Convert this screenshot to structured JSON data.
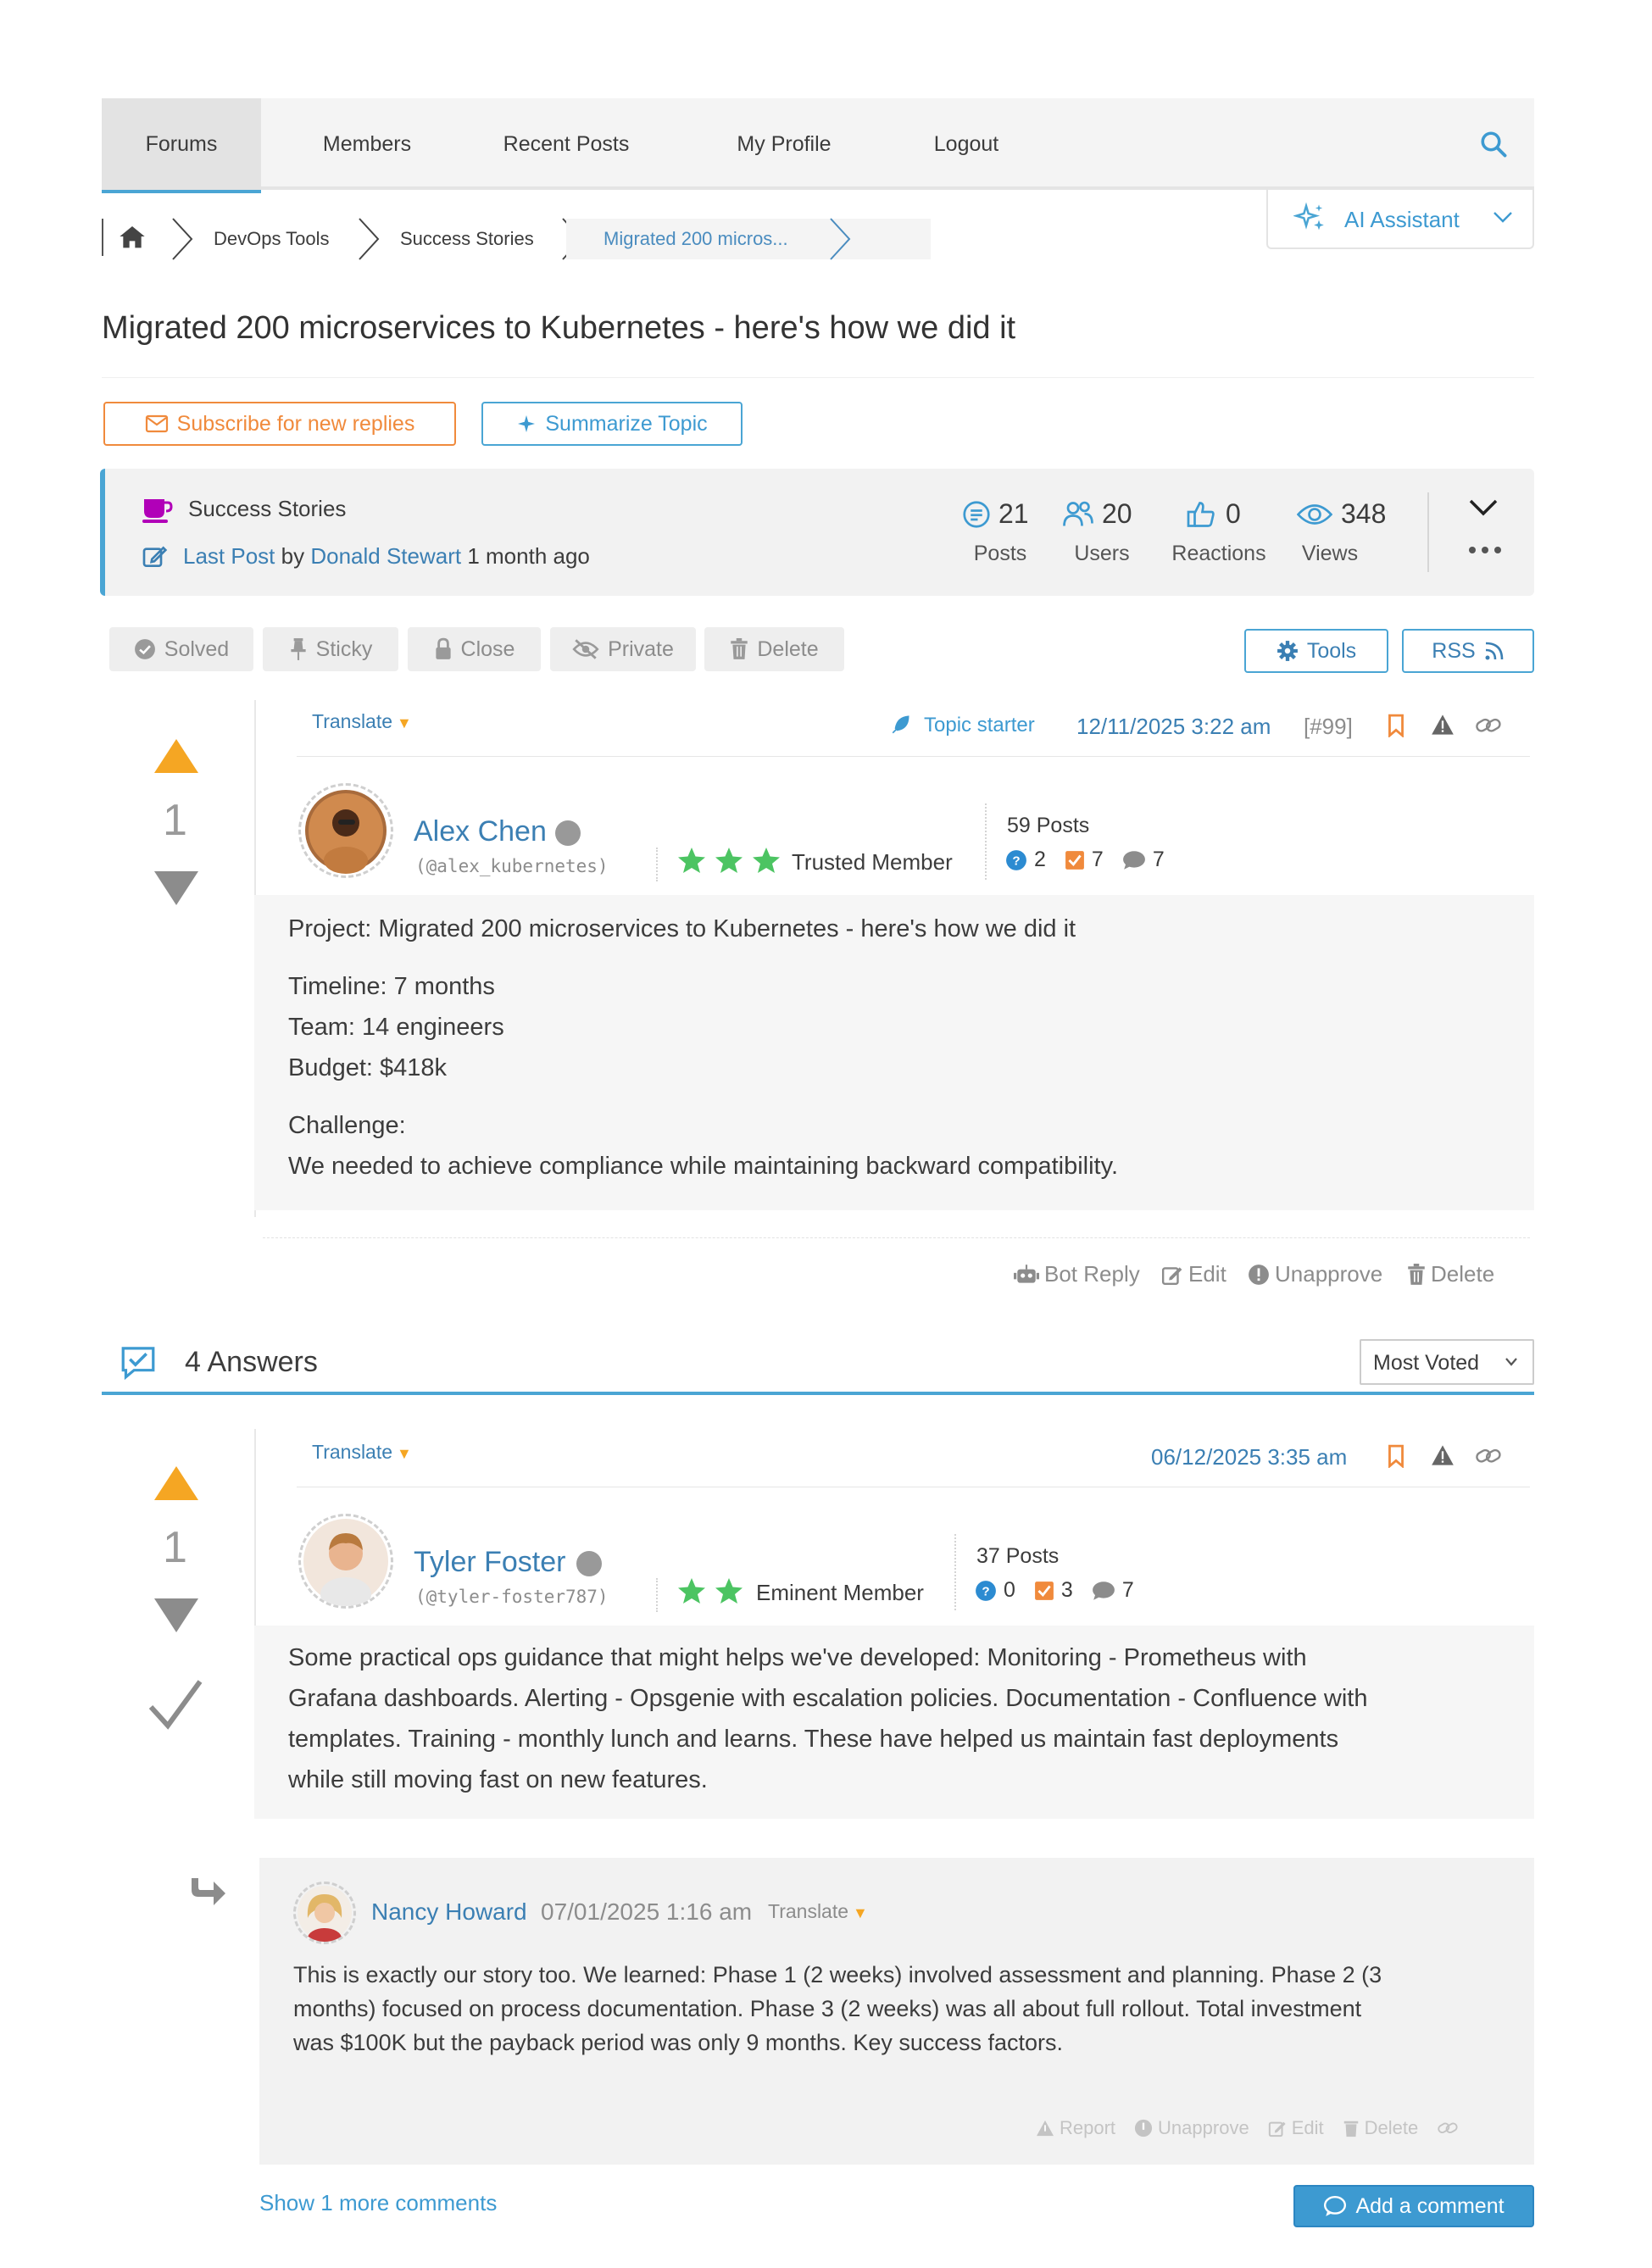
{
  "nav": {
    "tabs": [
      {
        "label": "Forums",
        "active": true
      },
      {
        "label": "Members"
      },
      {
        "label": "Recent Posts"
      },
      {
        "label": "My Profile"
      },
      {
        "label": "Logout"
      }
    ]
  },
  "breadcrumb": {
    "items": [
      "DevOps Tools",
      "Success Stories",
      "Migrated 200 micros..."
    ]
  },
  "ai_assistant": {
    "label": "AI Assistant"
  },
  "topic": {
    "title": "Migrated 200 microservices to Kubernetes - here's how we did it",
    "subscribe_label": "Subscribe for new replies",
    "summarize_label": "Summarize Topic"
  },
  "info": {
    "forum": "Success Stories",
    "last_post_label": "Last Post",
    "by": "by",
    "last_author": "Donald Stewart",
    "last_time": "1 month ago",
    "stats": [
      {
        "value": "21",
        "label": "Posts",
        "icon": "posts-icon"
      },
      {
        "value": "20",
        "label": "Users",
        "icon": "users-icon"
      },
      {
        "value": "0",
        "label": "Reactions",
        "icon": "reactions-icon"
      },
      {
        "value": "348",
        "label": "Views",
        "icon": "views-icon"
      }
    ]
  },
  "moderation": {
    "solved": "Solved",
    "sticky": "Sticky",
    "close": "Close",
    "private": "Private",
    "delete": "Delete",
    "tools": "Tools",
    "rss": "RSS"
  },
  "question": {
    "translate": "Translate",
    "topic_starter": "Topic starter",
    "date": "12/11/2025 3:22 am",
    "post_id": "[#99]",
    "votes": "1",
    "author": "Alex Chen",
    "handle": "(@alex_kubernetes)",
    "rank": "Trusted Member",
    "stars": 3,
    "posts": "59 Posts",
    "badge_questions": "2",
    "badge_answers": "7",
    "badge_comments": "7",
    "body": {
      "line1": "Project: Migrated 200 microservices to Kubernetes - here's how we did it",
      "timeline": "Timeline: 7 months",
      "team": "Team: 14 engineers",
      "budget": "Budget: $418k",
      "challenge": "Challenge:",
      "challenge_text": "We needed to achieve compliance while maintaining backward compatibility."
    },
    "actions": {
      "bot_reply": "Bot Reply",
      "edit": "Edit",
      "unapprove": "Unapprove",
      "delete": "Delete"
    }
  },
  "answers": {
    "count_label": "4 Answers",
    "sort": "Most Voted"
  },
  "answer1": {
    "translate": "Translate",
    "date": "06/12/2025 3:35 am",
    "votes": "1",
    "author": "Tyler Foster",
    "handle": "(@tyler-foster787)",
    "rank": "Eminent Member",
    "stars": 2,
    "posts": "37 Posts",
    "badge_questions": "0",
    "badge_answers": "3",
    "badge_comments": "7",
    "body": {
      "l1": "Some practical ops guidance that might helps we've developed: Monitoring - Prometheus with",
      "l2": "Grafana dashboards. Alerting - Opsgenie with escalation policies. Documentation - Confluence with",
      "l3": "templates. Training - monthly lunch and learns. These have helped us maintain fast deployments",
      "l4": "while still moving fast on new features."
    }
  },
  "comment": {
    "author": "Nancy Howard",
    "date": "07/01/2025 1:16 am",
    "translate": "Translate",
    "l1": "This is exactly our story too. We learned: Phase 1 (2 weeks) involved assessment and planning. Phase 2 (3",
    "l2": "months) focused on process documentation. Phase 3 (2 weeks) was all about full rollout. Total investment",
    "l3": "was $100K but the payback period was only 9 months. Key success factors.",
    "actions": {
      "report": "Report",
      "unapprove": "Unapprove",
      "edit": "Edit",
      "delete": "Delete"
    }
  },
  "footer": {
    "show_more": "Show 1 more comments",
    "add_comment": "Add a comment"
  },
  "colors": {
    "accent": "#4aa5d4",
    "link": "#3b7fb3",
    "orange": "#f5a623",
    "subscribe": "#f08a3c",
    "star": "#4cc462",
    "forum_icon": "#b100b8"
  }
}
